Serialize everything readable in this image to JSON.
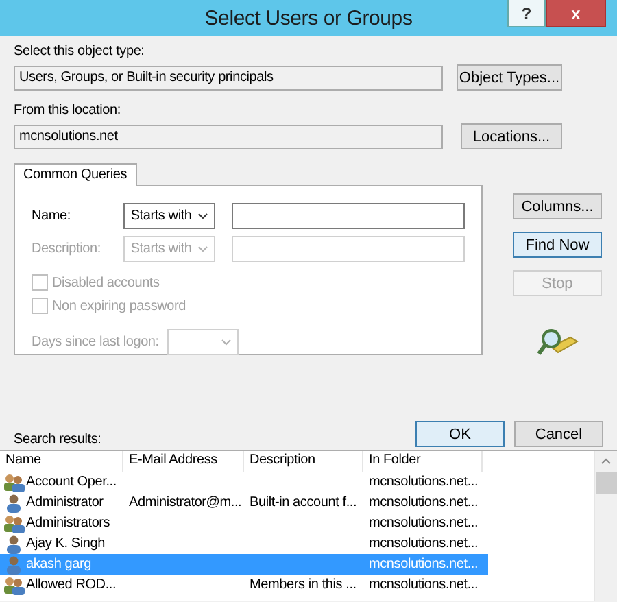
{
  "window": {
    "title": "Select Users or Groups",
    "help_button": "?",
    "close_button": "x"
  },
  "object_type": {
    "label": "Select this object type:",
    "value": "Users, Groups, or Built-in security principals",
    "button": "Object Types..."
  },
  "location": {
    "label": "From this location:",
    "value": "mcnsolutions.net",
    "button": "Locations..."
  },
  "tabs": [
    {
      "label": "Common Queries",
      "selected": true
    }
  ],
  "query": {
    "name_label": "Name:",
    "name_operator": "Starts with",
    "description_label": "Description:",
    "description_operator": "Starts with",
    "description_disabled": true,
    "checkboxes": [
      {
        "label": "Disabled accounts",
        "checked": false,
        "disabled": true
      },
      {
        "label": "Non expiring password",
        "checked": false,
        "disabled": true
      }
    ],
    "days_label": "Days since last logon:"
  },
  "side_buttons": [
    {
      "label": "Columns...",
      "disabled": false,
      "focused": false
    },
    {
      "label": "Find Now",
      "disabled": false,
      "focused": true
    },
    {
      "label": "Stop",
      "disabled": true,
      "focused": false
    }
  ],
  "ok_button": "OK",
  "cancel_button": "Cancel",
  "results": {
    "label": "Search results:",
    "columns": [
      "Name",
      "E-Mail Address",
      "Description",
      "In Folder"
    ],
    "rows": [
      {
        "kind": "group",
        "selected": false,
        "cells": [
          "Account Oper...",
          "",
          "",
          "mcnsolutions.net..."
        ]
      },
      {
        "kind": "user",
        "selected": false,
        "cells": [
          "Administrator",
          "Administrator@m...",
          "Built-in account f...",
          "mcnsolutions.net..."
        ]
      },
      {
        "kind": "group",
        "selected": false,
        "cells": [
          "Administrators",
          "",
          "",
          "mcnsolutions.net..."
        ]
      },
      {
        "kind": "user",
        "selected": false,
        "cells": [
          "Ajay K. Singh",
          "",
          "",
          "mcnsolutions.net..."
        ]
      },
      {
        "kind": "user",
        "selected": true,
        "cells": [
          "akash garg",
          "",
          "",
          "mcnsolutions.net..."
        ]
      },
      {
        "kind": "group",
        "selected": false,
        "cells": [
          "Allowed ROD...",
          "",
          "Members in this ...",
          "mcnsolutions.net..."
        ]
      }
    ]
  }
}
